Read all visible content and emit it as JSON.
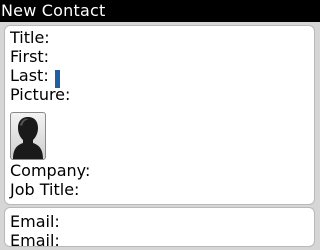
{
  "screen": {
    "title": "New Contact"
  },
  "details": {
    "title_label": "Title:",
    "first_label": "First:",
    "last_label": "Last:",
    "picture_label": "Picture:",
    "picture_icon": "default-person-silhouette",
    "company_label": "Company:",
    "job_title_label": "Job Title:"
  },
  "contact": {
    "email_label": "Email:",
    "email2_label": "Email:"
  },
  "colors": {
    "title_bar": "#000000",
    "cursor": "#1f5fa6",
    "panel_bg": "#ffffff",
    "screen_bg": "#d6d6d6"
  }
}
